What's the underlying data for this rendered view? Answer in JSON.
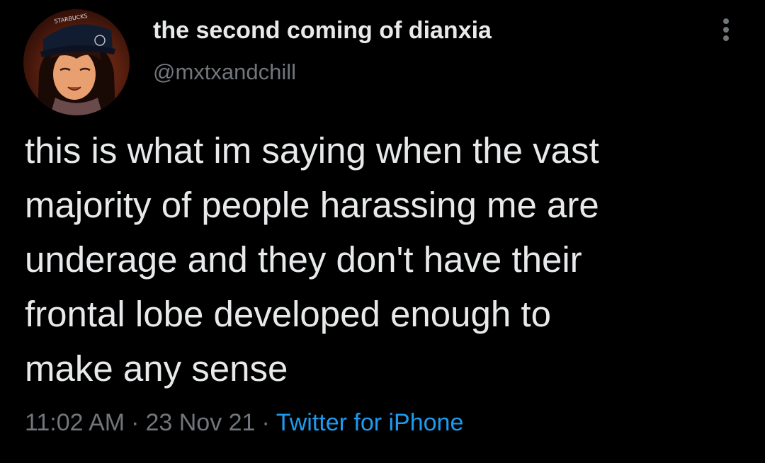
{
  "tweet": {
    "author": {
      "display_name": "the second coming of dianxia",
      "handle": "@mxtxandchill",
      "avatar_cap_text": "STARBUCKS"
    },
    "text_lines": [
      "this is what im saying when the vast",
      "majority of people harassing me are",
      "underage and they don't have their",
      "frontal lobe developed enough to",
      "make any sense"
    ],
    "time": "11:02 AM",
    "separator": "·",
    "date": "23 Nov 21",
    "source": "Twitter for iPhone",
    "more_icon": "more-vertical-icon"
  },
  "colors": {
    "background": "#000000",
    "primary_text": "#e7e9ea",
    "secondary_text": "#71767b",
    "link": "#1d9bf0"
  }
}
